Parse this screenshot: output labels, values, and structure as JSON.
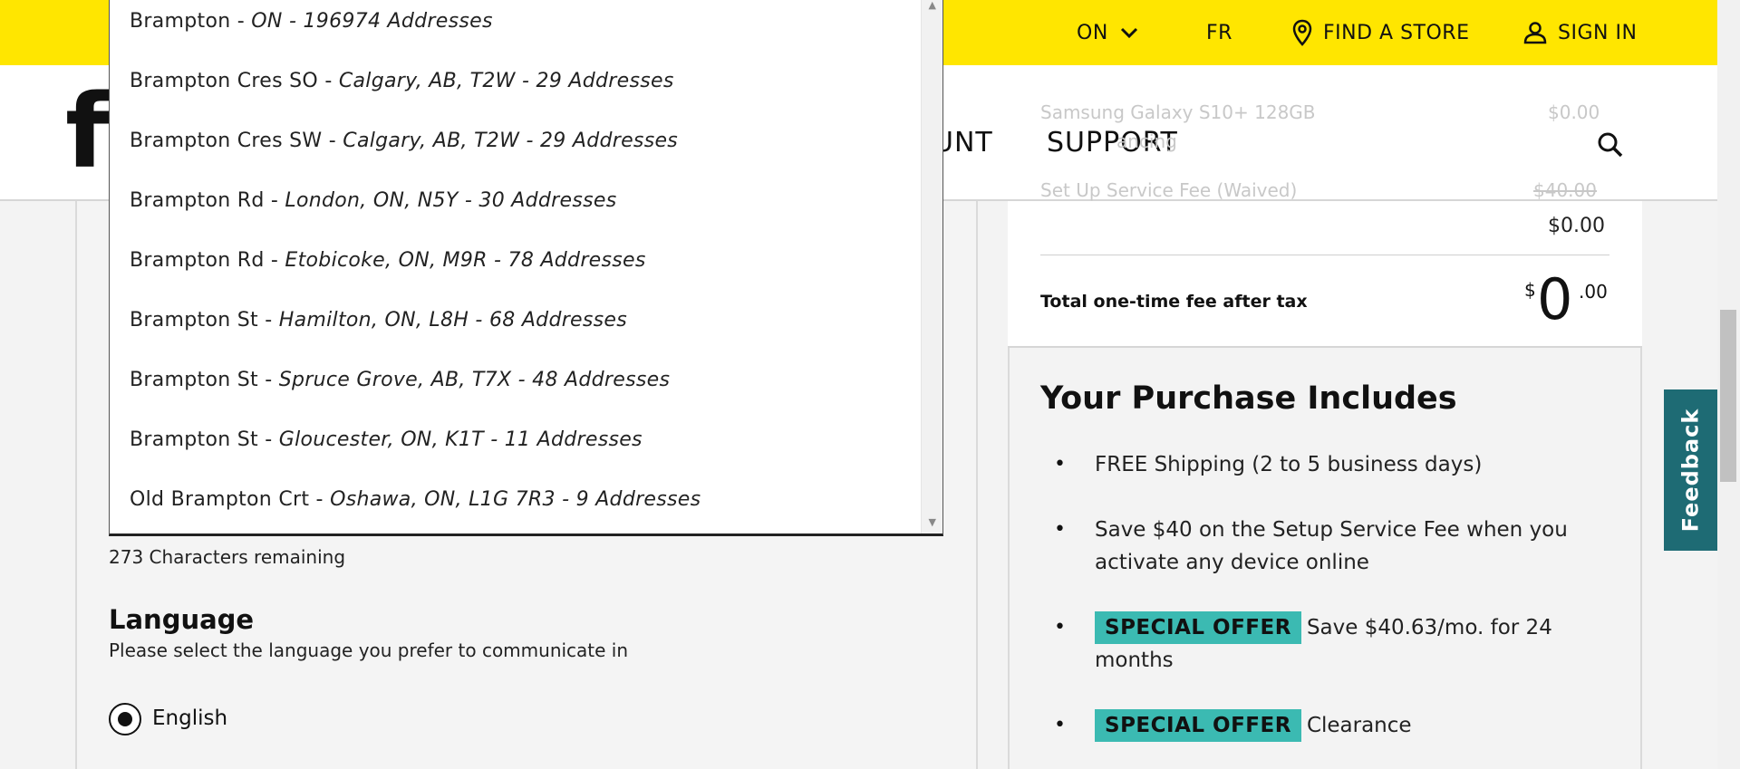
{
  "utility_bar": {
    "province": "ON",
    "language_toggle": "FR",
    "find_store": "FIND A STORE",
    "sign_in": "SIGN IN"
  },
  "nav": {
    "logo_partial": "fi",
    "account_partial": "UNT",
    "support": "SUPPORT"
  },
  "address_dropdown": {
    "items": [
      {
        "street": "Brampton - ",
        "location": "ON - 196974 Addresses"
      },
      {
        "street": "Brampton Cres SO - ",
        "location": "Calgary, AB, T2W - 29 Addresses"
      },
      {
        "street": "Brampton Cres SW - ",
        "location": "Calgary, AB, T2W - 29 Addresses"
      },
      {
        "street": "Brampton Rd - ",
        "location": "London, ON, N5Y - 30 Addresses"
      },
      {
        "street": "Brampton Rd - ",
        "location": "Etobicoke, ON, M9R - 78 Addresses"
      },
      {
        "street": "Brampton St - ",
        "location": "Hamilton, ON, L8H - 68 Addresses"
      },
      {
        "street": "Brampton St - ",
        "location": "Spruce Grove, AB, T7X - 48 Addresses"
      },
      {
        "street": "Brampton St - ",
        "location": "Gloucester, ON, K1T - 11 Addresses"
      },
      {
        "street": "Old Brampton Crt - ",
        "location": "Oshawa, ON, L1G 7R3 - 9 Addresses"
      }
    ]
  },
  "form": {
    "chars_remaining": "273 Characters remaining",
    "language_title": "Language",
    "language_sub": "Please select the language you prefer to communicate in",
    "language_option": "English"
  },
  "summary": {
    "faded_device": "Samsung Galaxy S10+ 128GB",
    "faded_device_sub": "ancing",
    "faded_device_price": "$0.00",
    "faded_fee": "Set Up Service Fee (Waived)",
    "faded_fee_price": "$40.00",
    "subtotal": "$0.00",
    "total_label": "Total one-time fee after tax",
    "total_currency": "$",
    "total_dollars": "0",
    "total_cents": ".00"
  },
  "includes": {
    "title": "Your Purchase Includes",
    "items": [
      {
        "badge": "",
        "text": "FREE Shipping (2 to 5 business days)"
      },
      {
        "badge": "",
        "text": "Save $40 on the Setup Service Fee when you activate any device online"
      },
      {
        "badge": "SPECIAL OFFER",
        "text": "Save $40.63/mo. for 24 months"
      },
      {
        "badge": "SPECIAL OFFER",
        "text": "Clearance"
      }
    ]
  },
  "feedback_label": "Feedback",
  "colors": {
    "brand_yellow": "#ffe600",
    "badge_teal": "#3bbab2",
    "feedback_teal": "#1e6b74"
  }
}
